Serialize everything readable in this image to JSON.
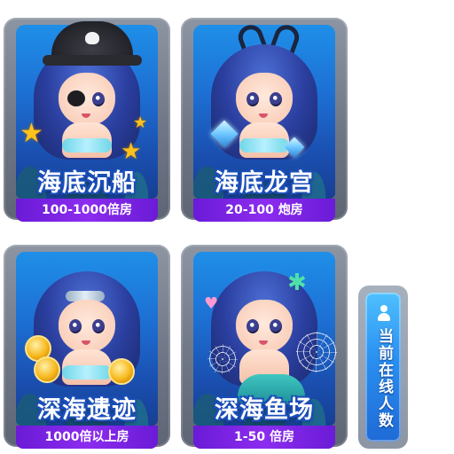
{
  "rooms": [
    {
      "title": "海底沉船",
      "tag": "100-1000倍房"
    },
    {
      "title": "海底龙宫",
      "tag": "20-100 炮房"
    },
    {
      "title": "深海遗迹",
      "tag": "1000倍以上房"
    },
    {
      "title": "深海鱼场",
      "tag": "1-50  倍房"
    }
  ],
  "online": {
    "label": "当前在线人数",
    "icon": "person-icon"
  },
  "colors": {
    "card_frame": "#7a8291",
    "panel_blue": "#1d6fd3",
    "tag_purple": "#7f24e6",
    "title_outline": "#1b4fb8"
  }
}
